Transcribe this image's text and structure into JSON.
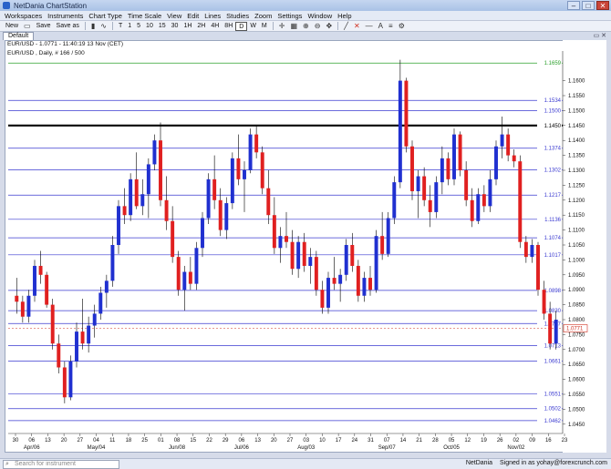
{
  "window": {
    "title": "NetDania ChartStation",
    "buttons": [
      "–",
      "□",
      "✕"
    ]
  },
  "menu": [
    "Workspaces",
    "Instruments",
    "Chart Type",
    "Time Scale",
    "View",
    "Edit",
    "Lines",
    "Studies",
    "Zoom",
    "Settings",
    "Window",
    "Help"
  ],
  "toolbar": {
    "new_label": "New",
    "save_label": "Save",
    "saveas_label": "Save as",
    "intervals": [
      "T",
      "1",
      "5",
      "10",
      "15",
      "30",
      "1H",
      "2H",
      "4H",
      "8H",
      "D",
      "W",
      "M"
    ],
    "selected_interval": "D"
  },
  "tab": {
    "label": "Default"
  },
  "chart": {
    "header": "EUR/USD - 1.0771 - 11:40:19 13 Nov (CET)",
    "subheader": "EUR/USD , Daily, # 166 / 500"
  },
  "chart_data": {
    "type": "candlestick",
    "title": "EUR/USD , Daily",
    "ylim": [
      1.0425,
      1.1675
    ],
    "y_ticks": [
      1.045,
      1.05,
      1.055,
      1.06,
      1.065,
      1.07,
      1.075,
      1.08,
      1.085,
      1.09,
      1.095,
      1.1,
      1.105,
      1.11,
      1.115,
      1.12,
      1.125,
      1.13,
      1.135,
      1.14,
      1.145,
      1.15,
      1.155,
      1.16
    ],
    "x_tick_labels": [
      "30",
      "06",
      "13",
      "20",
      "27",
      "04",
      "11",
      "18",
      "25",
      "01",
      "08",
      "15",
      "22",
      "29",
      "06",
      "13",
      "20",
      "27",
      "03",
      "10",
      "17",
      "24",
      "31",
      "07",
      "14",
      "21",
      "28",
      "05",
      "12",
      "19",
      "26",
      "02",
      "09",
      "16",
      "23"
    ],
    "month_labels": [
      {
        "label": "Apr/06",
        "index": 1
      },
      {
        "label": "May/04",
        "index": 5
      },
      {
        "label": "Jun/08",
        "index": 10
      },
      {
        "label": "Jul/06",
        "index": 14
      },
      {
        "label": "Aug/03",
        "index": 18
      },
      {
        "label": "Sep/07",
        "index": 23
      },
      {
        "label": "Oct/05",
        "index": 27
      },
      {
        "label": "Nov/02",
        "index": 31
      }
    ],
    "horizontal_lines": [
      {
        "value": 1.1659,
        "label": "1.1659",
        "color": "#2ca02c"
      },
      {
        "value": 1.1534,
        "label": "1.1534",
        "color": "#3a3ad0"
      },
      {
        "value": 1.15,
        "label": "1.1500",
        "color": "#3a3ad0"
      },
      {
        "value": 1.145,
        "label": "1.1450",
        "color": "#000000",
        "bold": true
      },
      {
        "value": 1.1374,
        "label": "1.1374",
        "color": "#3a3ad0"
      },
      {
        "value": 1.1302,
        "label": "1.1302",
        "color": "#3a3ad0"
      },
      {
        "value": 1.1217,
        "label": "1.1217",
        "color": "#3a3ad0"
      },
      {
        "value": 1.1136,
        "label": "1.1136",
        "color": "#3a3ad0"
      },
      {
        "value": 1.1074,
        "label": "1.1074",
        "color": "#3a3ad0"
      },
      {
        "value": 1.1017,
        "label": "1.1017",
        "color": "#3a3ad0"
      },
      {
        "value": 1.0898,
        "label": "1.0898",
        "color": "#3a3ad0"
      },
      {
        "value": 1.083,
        "label": "1.0830",
        "color": "#3a3ad0"
      },
      {
        "value": 1.0787,
        "label": "1.0787",
        "color": "#3a3ad0"
      },
      {
        "value": 1.0713,
        "label": "1.0713",
        "color": "#3a3ad0"
      },
      {
        "value": 1.0661,
        "label": "1.0661",
        "color": "#3a3ad0"
      },
      {
        "value": 1.0551,
        "label": "1.0551",
        "color": "#3a3ad0"
      },
      {
        "value": 1.0502,
        "label": "1.0502",
        "color": "#3a3ad0"
      },
      {
        "value": 1.0462,
        "label": "1.0462",
        "color": "#3a3ad0"
      }
    ],
    "current_price": {
      "value": 1.0771,
      "label": "1.0771",
      "color": "#d03020"
    },
    "up_color": "#2030d0",
    "down_color": "#e02020",
    "candles": [
      [
        1.088,
        1.094,
        1.082,
        1.086
      ],
      [
        1.086,
        1.088,
        1.079,
        1.081
      ],
      [
        1.081,
        1.09,
        1.079,
        1.088
      ],
      [
        1.088,
        1.1,
        1.086,
        1.098
      ],
      [
        1.098,
        1.103,
        1.092,
        1.095
      ],
      [
        1.095,
        1.096,
        1.084,
        1.085
      ],
      [
        1.085,
        1.087,
        1.07,
        1.072
      ],
      [
        1.072,
        1.075,
        1.062,
        1.064
      ],
      [
        1.064,
        1.066,
        1.052,
        1.054
      ],
      [
        1.054,
        1.068,
        1.053,
        1.066
      ],
      [
        1.066,
        1.079,
        1.064,
        1.076
      ],
      [
        1.076,
        1.087,
        1.07,
        1.072
      ],
      [
        1.072,
        1.081,
        1.069,
        1.078
      ],
      [
        1.078,
        1.085,
        1.074,
        1.082
      ],
      [
        1.082,
        1.091,
        1.08,
        1.089
      ],
      [
        1.089,
        1.095,
        1.084,
        1.093
      ],
      [
        1.093,
        1.108,
        1.091,
        1.105
      ],
      [
        1.105,
        1.12,
        1.102,
        1.118
      ],
      [
        1.118,
        1.124,
        1.112,
        1.115
      ],
      [
        1.115,
        1.129,
        1.113,
        1.127
      ],
      [
        1.127,
        1.136,
        1.117,
        1.118
      ],
      [
        1.118,
        1.127,
        1.115,
        1.122
      ],
      [
        1.122,
        1.134,
        1.114,
        1.132
      ],
      [
        1.132,
        1.142,
        1.13,
        1.14
      ],
      [
        1.14,
        1.146,
        1.118,
        1.12
      ],
      [
        1.12,
        1.128,
        1.11,
        1.113
      ],
      [
        1.113,
        1.118,
        1.099,
        1.101
      ],
      [
        1.101,
        1.103,
        1.088,
        1.09
      ],
      [
        1.09,
        1.098,
        1.083,
        1.096
      ],
      [
        1.096,
        1.101,
        1.09,
        1.092
      ],
      [
        1.092,
        1.106,
        1.09,
        1.104
      ],
      [
        1.104,
        1.116,
        1.101,
        1.114
      ],
      [
        1.114,
        1.129,
        1.112,
        1.127
      ],
      [
        1.127,
        1.135,
        1.117,
        1.12
      ],
      [
        1.12,
        1.124,
        1.108,
        1.11
      ],
      [
        1.11,
        1.121,
        1.107,
        1.119
      ],
      [
        1.119,
        1.136,
        1.117,
        1.134
      ],
      [
        1.134,
        1.142,
        1.125,
        1.127
      ],
      [
        1.127,
        1.133,
        1.116,
        1.13
      ],
      [
        1.13,
        1.144,
        1.129,
        1.142
      ],
      [
        1.142,
        1.145,
        1.134,
        1.136
      ],
      [
        1.136,
        1.138,
        1.122,
        1.124
      ],
      [
        1.124,
        1.13,
        1.112,
        1.115
      ],
      [
        1.115,
        1.121,
        1.102,
        1.104
      ],
      [
        1.104,
        1.111,
        1.099,
        1.108
      ],
      [
        1.108,
        1.116,
        1.104,
        1.106
      ],
      [
        1.106,
        1.11,
        1.095,
        1.097
      ],
      [
        1.097,
        1.108,
        1.094,
        1.106
      ],
      [
        1.106,
        1.109,
        1.096,
        1.098
      ],
      [
        1.098,
        1.104,
        1.092,
        1.101
      ],
      [
        1.101,
        1.103,
        1.088,
        1.09
      ],
      [
        1.09,
        1.093,
        1.082,
        1.084
      ],
      [
        1.084,
        1.096,
        1.082,
        1.094
      ],
      [
        1.094,
        1.101,
        1.09,
        1.092
      ],
      [
        1.092,
        1.097,
        1.086,
        1.095
      ],
      [
        1.095,
        1.107,
        1.093,
        1.105
      ],
      [
        1.105,
        1.109,
        1.096,
        1.098
      ],
      [
        1.098,
        1.1,
        1.086,
        1.088
      ],
      [
        1.088,
        1.096,
        1.086,
        1.094
      ],
      [
        1.094,
        1.098,
        1.088,
        1.09
      ],
      [
        1.09,
        1.11,
        1.089,
        1.108
      ],
      [
        1.108,
        1.116,
        1.1,
        1.102
      ],
      [
        1.102,
        1.116,
        1.101,
        1.114
      ],
      [
        1.114,
        1.128,
        1.112,
        1.126
      ],
      [
        1.126,
        1.167,
        1.124,
        1.16
      ],
      [
        1.16,
        1.161,
        1.136,
        1.138
      ],
      [
        1.138,
        1.14,
        1.12,
        1.123
      ],
      [
        1.123,
        1.13,
        1.114,
        1.128
      ],
      [
        1.128,
        1.131,
        1.118,
        1.12
      ],
      [
        1.12,
        1.125,
        1.111,
        1.116
      ],
      [
        1.116,
        1.128,
        1.114,
        1.126
      ],
      [
        1.126,
        1.138,
        1.122,
        1.134
      ],
      [
        1.134,
        1.136,
        1.125,
        1.127
      ],
      [
        1.127,
        1.144,
        1.125,
        1.142
      ],
      [
        1.142,
        1.143,
        1.128,
        1.13
      ],
      [
        1.13,
        1.133,
        1.118,
        1.12
      ],
      [
        1.12,
        1.124,
        1.111,
        1.113
      ],
      [
        1.113,
        1.124,
        1.112,
        1.122
      ],
      [
        1.122,
        1.125,
        1.116,
        1.118
      ],
      [
        1.118,
        1.13,
        1.116,
        1.127
      ],
      [
        1.127,
        1.14,
        1.125,
        1.138
      ],
      [
        1.138,
        1.148,
        1.134,
        1.142
      ],
      [
        1.142,
        1.144,
        1.133,
        1.135
      ],
      [
        1.135,
        1.137,
        1.131,
        1.133
      ],
      [
        1.133,
        1.135,
        1.104,
        1.106
      ],
      [
        1.106,
        1.108,
        1.099,
        1.101
      ],
      [
        1.101,
        1.107,
        1.099,
        1.105
      ],
      [
        1.105,
        1.106,
        1.088,
        1.09
      ],
      [
        1.09,
        1.093,
        1.08,
        1.082
      ],
      [
        1.082,
        1.086,
        1.07,
        1.072
      ],
      [
        1.072,
        1.083,
        1.07,
        1.08
      ]
    ]
  },
  "status": {
    "search_placeholder": "Search for instrument",
    "brand": "NetDania",
    "signed_in": "Signed in as yohay@forexcrunch.com"
  }
}
